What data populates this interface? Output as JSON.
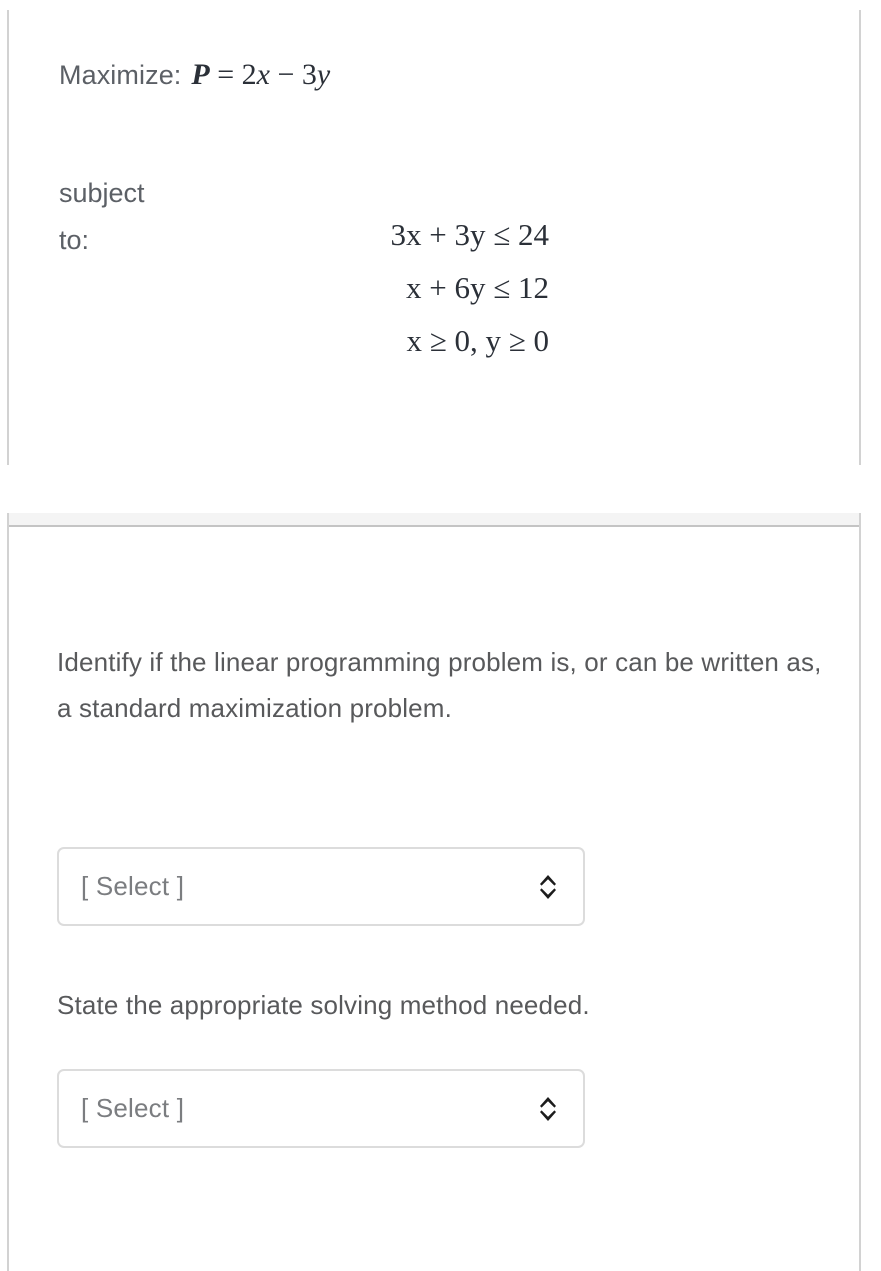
{
  "problem": {
    "objective_label": "Maximize:",
    "objective_expression": "P = 2x − 3y",
    "objective_parts": {
      "variable": "P",
      "equals": "=",
      "term1": "2x",
      "operator": "−",
      "term2": "3y"
    },
    "subject_label_line1": "subject",
    "subject_label_line2": "to:",
    "constraints": [
      "3x + 3y ≤ 24",
      "x + 6y ≤ 12",
      "x ≥ 0, y ≥ 0"
    ]
  },
  "question": {
    "prompt_1": "Identify if the linear programming problem is, or can be written as, a standard maximization problem.",
    "prompt_2": "State the appropriate solving method needed.",
    "selects": [
      {
        "name": "standard-maximization",
        "value": "[ Select ]",
        "caret_icon": "chevron-up-down-icon"
      },
      {
        "name": "solving-method",
        "value": "[ Select ]",
        "caret_icon": "chevron-up-down-icon"
      }
    ]
  },
  "colors": {
    "text_gray": "#58595b",
    "math_dark": "#2b3038",
    "border_gray": "#d2d2d2",
    "select_border": "#dcdcdc",
    "placeholder_gray": "#7b7d80",
    "header_strip": "#f4f4f4"
  }
}
